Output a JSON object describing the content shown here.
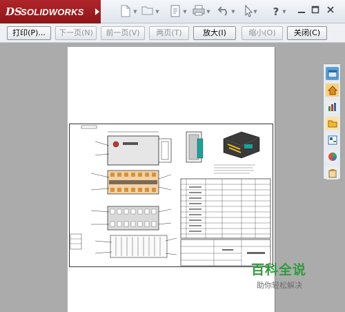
{
  "titlebar": {
    "logo_ds": "DS",
    "logo_text": "SOLIDWORKS",
    "help_label": "?",
    "icons": [
      "new-file-icon",
      "open-file-icon",
      "file-properties-icon",
      "print-icon",
      "undo-icon",
      "select-icon",
      "help-icon"
    ],
    "window_controls": [
      "minimize-icon",
      "restore-icon",
      "close-icon"
    ]
  },
  "toolbar": {
    "print_label": "打印(P)...",
    "next_page_label": "下一页(N)",
    "prev_page_label": "前一页(V)",
    "two_page_label": "两页(T)",
    "zoom_in_label": "放大(I)",
    "zoom_out_label": "缩小(O)",
    "close_label": "关闭(C)"
  },
  "taskpane": {
    "icons": [
      "solidworks-resources-icon",
      "home-icon",
      "design-library-icon",
      "file-explorer-icon",
      "view-palette-icon",
      "appearances-icon",
      "custom-properties-icon"
    ]
  },
  "watermark": {
    "title": "百科全说",
    "subtitle": "助你轻松解决"
  },
  "colors": {
    "brand_red": "#a31d21",
    "watermark_green": "#2e9b3b",
    "preview_bg": "#ababab"
  }
}
